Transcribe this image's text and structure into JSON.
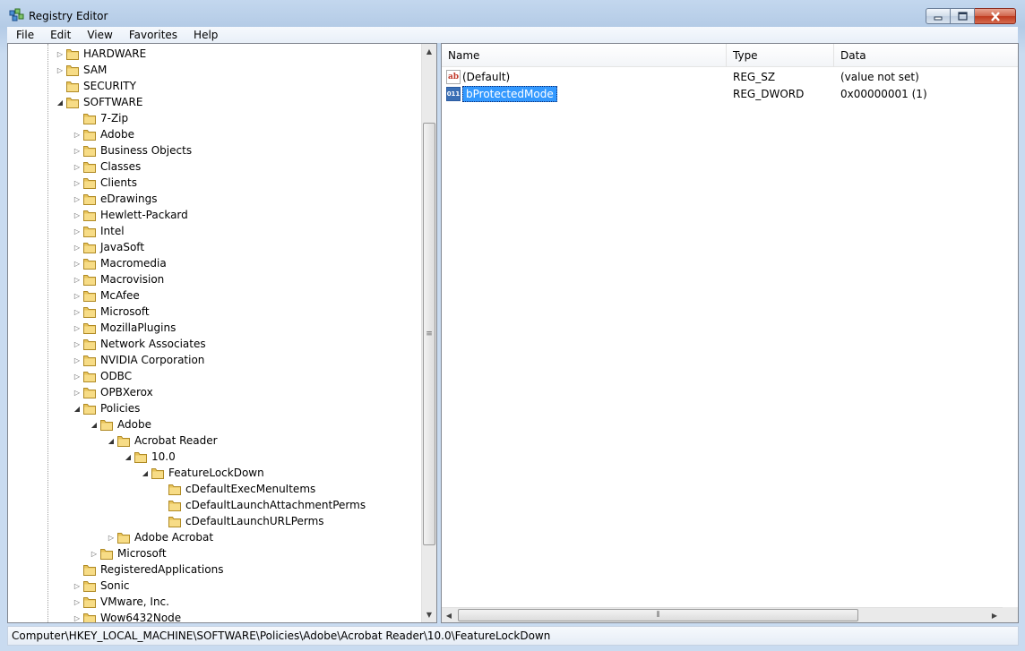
{
  "window": {
    "title": "Registry Editor",
    "min_glyph": "▁",
    "max_glyph": "□",
    "close_glyph": "✕"
  },
  "menu": [
    "File",
    "Edit",
    "View",
    "Favorites",
    "Help"
  ],
  "tree": {
    "nodes": [
      {
        "label": "HARDWARE",
        "depth": 0,
        "expander": "collapsed"
      },
      {
        "label": "SAM",
        "depth": 0,
        "expander": "collapsed"
      },
      {
        "label": "SECURITY",
        "depth": 0,
        "expander": "none"
      },
      {
        "label": "SOFTWARE",
        "depth": 0,
        "expander": "expanded"
      },
      {
        "label": "7-Zip",
        "depth": 1,
        "expander": "none"
      },
      {
        "label": "Adobe",
        "depth": 1,
        "expander": "collapsed"
      },
      {
        "label": "Business Objects",
        "depth": 1,
        "expander": "collapsed"
      },
      {
        "label": "Classes",
        "depth": 1,
        "expander": "collapsed"
      },
      {
        "label": "Clients",
        "depth": 1,
        "expander": "collapsed"
      },
      {
        "label": "eDrawings",
        "depth": 1,
        "expander": "collapsed"
      },
      {
        "label": "Hewlett-Packard",
        "depth": 1,
        "expander": "collapsed"
      },
      {
        "label": "Intel",
        "depth": 1,
        "expander": "collapsed"
      },
      {
        "label": "JavaSoft",
        "depth": 1,
        "expander": "collapsed"
      },
      {
        "label": "Macromedia",
        "depth": 1,
        "expander": "collapsed"
      },
      {
        "label": "Macrovision",
        "depth": 1,
        "expander": "collapsed"
      },
      {
        "label": "McAfee",
        "depth": 1,
        "expander": "collapsed"
      },
      {
        "label": "Microsoft",
        "depth": 1,
        "expander": "collapsed"
      },
      {
        "label": "MozillaPlugins",
        "depth": 1,
        "expander": "collapsed"
      },
      {
        "label": "Network Associates",
        "depth": 1,
        "expander": "collapsed"
      },
      {
        "label": "NVIDIA Corporation",
        "depth": 1,
        "expander": "collapsed"
      },
      {
        "label": "ODBC",
        "depth": 1,
        "expander": "collapsed"
      },
      {
        "label": "OPBXerox",
        "depth": 1,
        "expander": "collapsed"
      },
      {
        "label": "Policies",
        "depth": 1,
        "expander": "expanded"
      },
      {
        "label": "Adobe",
        "depth": 2,
        "expander": "expanded"
      },
      {
        "label": "Acrobat Reader",
        "depth": 3,
        "expander": "expanded"
      },
      {
        "label": "10.0",
        "depth": 4,
        "expander": "expanded"
      },
      {
        "label": "FeatureLockDown",
        "depth": 5,
        "expander": "expanded"
      },
      {
        "label": "cDefaultExecMenuItems",
        "depth": 6,
        "expander": "none"
      },
      {
        "label": "cDefaultLaunchAttachmentPerms",
        "depth": 6,
        "expander": "none"
      },
      {
        "label": "cDefaultLaunchURLPerms",
        "depth": 6,
        "expander": "none"
      },
      {
        "label": "Adobe Acrobat",
        "depth": 3,
        "expander": "collapsed"
      },
      {
        "label": "Microsoft",
        "depth": 2,
        "expander": "collapsed"
      },
      {
        "label": "RegisteredApplications",
        "depth": 1,
        "expander": "none"
      },
      {
        "label": "Sonic",
        "depth": 1,
        "expander": "collapsed"
      },
      {
        "label": "VMware, Inc.",
        "depth": 1,
        "expander": "collapsed"
      },
      {
        "label": "Wow6432Node",
        "depth": 1,
        "expander": "collapsed"
      }
    ],
    "scroll_up_glyph": "▲",
    "scroll_down_glyph": "▼",
    "grip_glyph": "≡"
  },
  "list": {
    "columns": [
      "Name",
      "Type",
      "Data"
    ],
    "rows": [
      {
        "icon": "string-value-icon",
        "icon_text": "ab",
        "name": "(Default)",
        "type": "REG_SZ",
        "data": "(value not set)",
        "selected": false
      },
      {
        "icon": "dword-value-icon",
        "icon_text": "011",
        "name": "bProtectedMode",
        "type": "REG_DWORD",
        "data": "0x00000001 (1)",
        "selected": true
      }
    ],
    "scroll_left_glyph": "◀",
    "scroll_right_glyph": "▶",
    "grip_glyph": "⦀"
  },
  "status": {
    "path": "Computer\\HKEY_LOCAL_MACHINE\\SOFTWARE\\Policies\\Adobe\\Acrobat Reader\\10.0\\FeatureLockDown"
  },
  "colors": {
    "selection": "#3399ff",
    "folder": "#e8c35a",
    "chrome": "#c3d7ee"
  }
}
